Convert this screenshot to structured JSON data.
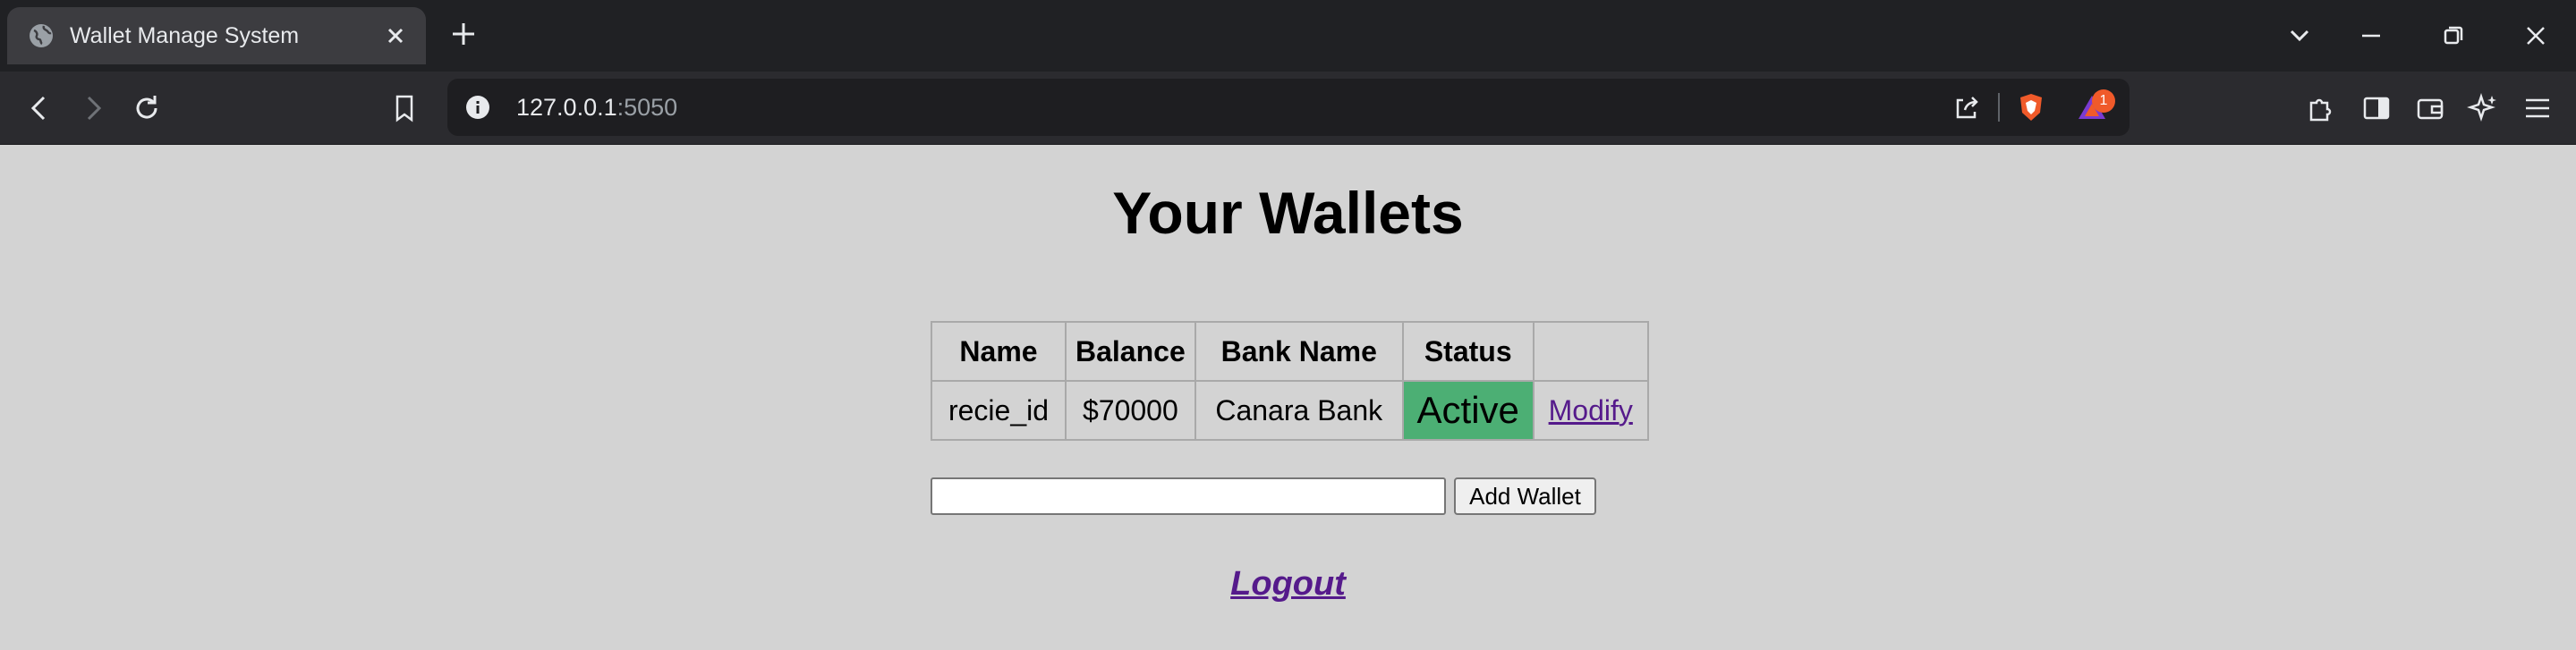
{
  "browser": {
    "tab": {
      "title": "Wallet Manage System"
    },
    "omnibox": {
      "url_host": "127.0.0.1",
      "url_port": ":5050"
    },
    "extension_badge": "1"
  },
  "page": {
    "title": "Your Wallets",
    "table": {
      "headers": [
        "Name",
        "Balance",
        "Bank Name",
        "Status",
        ""
      ],
      "rows": [
        {
          "name": "recie_id",
          "balance": "$70000",
          "bank_name": "Canara Bank",
          "status": "Active",
          "action": "Modify"
        }
      ]
    },
    "add_wallet": {
      "input_value": "",
      "button_label": "Add Wallet"
    },
    "logout_label": "Logout"
  },
  "colors": {
    "status_active": "#4caf74",
    "link": "#551a8b",
    "page_bg": "#d3d3d3"
  }
}
